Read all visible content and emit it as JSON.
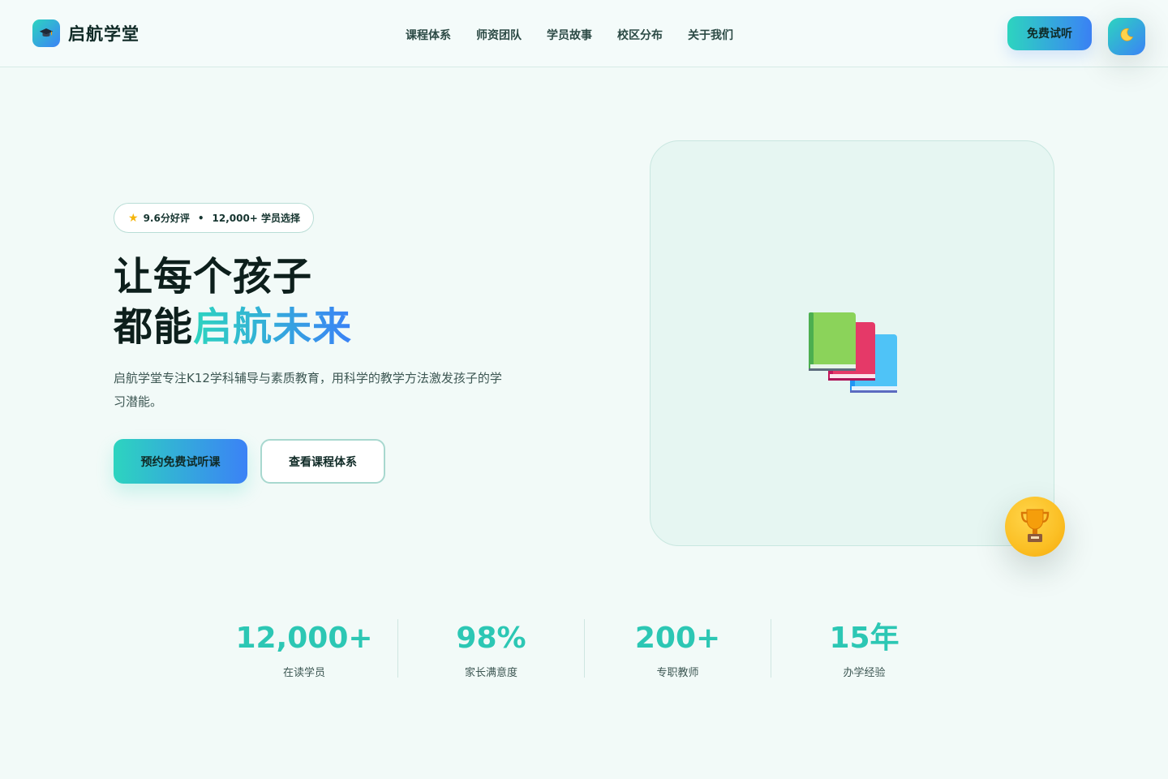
{
  "brand": {
    "name": "启航学堂",
    "logo_icon": "graduation-cap-icon"
  },
  "nav": {
    "links": [
      "课程体系",
      "师资团队",
      "学员故事",
      "校区分布",
      "关于我们"
    ],
    "cta": "免费试听",
    "theme_toggle_icon": "moon-icon"
  },
  "hero": {
    "badge": {
      "rating": "9.6分好评",
      "separator": "•",
      "students": "12,000+ 学员选择",
      "icon": "star-icon"
    },
    "headline_line1": "让每个孩子",
    "headline_line2_plain": "都能",
    "headline_line2_accent": "启航未来",
    "description": "启航学堂专注K12学科辅导与素质教育，用科学的教学方法激发孩子的学习潜能。",
    "primary_button": "预约免费试听课",
    "secondary_button": "查看课程体系",
    "illustration_icon": "books-icon",
    "floating_icon": "trophy-icon"
  },
  "stats": [
    {
      "value": "12,000+",
      "label": "在读学员"
    },
    {
      "value": "98%",
      "label": "家长满意度"
    },
    {
      "value": "200+",
      "label": "专职教师"
    },
    {
      "value": "15年",
      "label": "办学经验"
    }
  ],
  "colors": {
    "accent_start": "#2dd4bf",
    "accent_end": "#3b82f6",
    "background": "#f2faf8",
    "text_dark": "#0d1f1c",
    "stat_value": "#2cc7b4",
    "trophy_bg": "#fbbf24"
  }
}
